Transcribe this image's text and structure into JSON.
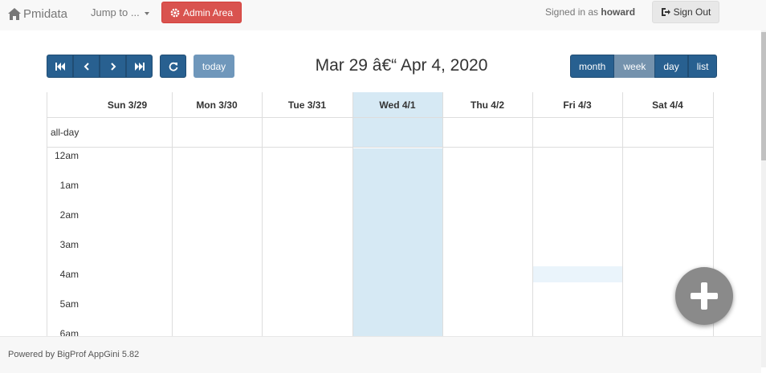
{
  "navbar": {
    "brand": "Pmidata",
    "jump_label": "Jump to ...",
    "admin_label": "Admin Area",
    "signed_in_prefix": "Signed in as",
    "username": "howard",
    "signout_label": "Sign Out"
  },
  "toolbar": {
    "today_label": "today",
    "title": "Mar 29 â€“ Apr 4, 2020",
    "views": [
      {
        "label": "month",
        "active": false
      },
      {
        "label": "week",
        "active": true
      },
      {
        "label": "day",
        "active": false
      },
      {
        "label": "list",
        "active": false
      }
    ]
  },
  "calendar": {
    "days": [
      "Sun 3/29",
      "Mon 3/30",
      "Tue 3/31",
      "Wed 4/1",
      "Thu 4/2",
      "Fri 4/3",
      "Sat 4/4"
    ],
    "today": "Wed 4/1",
    "allday_label": "all-day",
    "times": [
      "12am",
      "1am",
      "2am",
      "3am",
      "4am",
      "5am",
      "6am"
    ]
  },
  "footer": {
    "text": "Powered by BigProf AppGini 5.82"
  },
  "colors": {
    "primary": "#286090",
    "danger": "#d9534f",
    "today_bg": "#d6e9f4",
    "fab": "#8a8a8a"
  },
  "icons": [
    "home-icon",
    "cog-icon",
    "logout-icon",
    "first-icon",
    "prev-icon",
    "next-icon",
    "last-icon",
    "refresh-icon",
    "plus-icon"
  ]
}
